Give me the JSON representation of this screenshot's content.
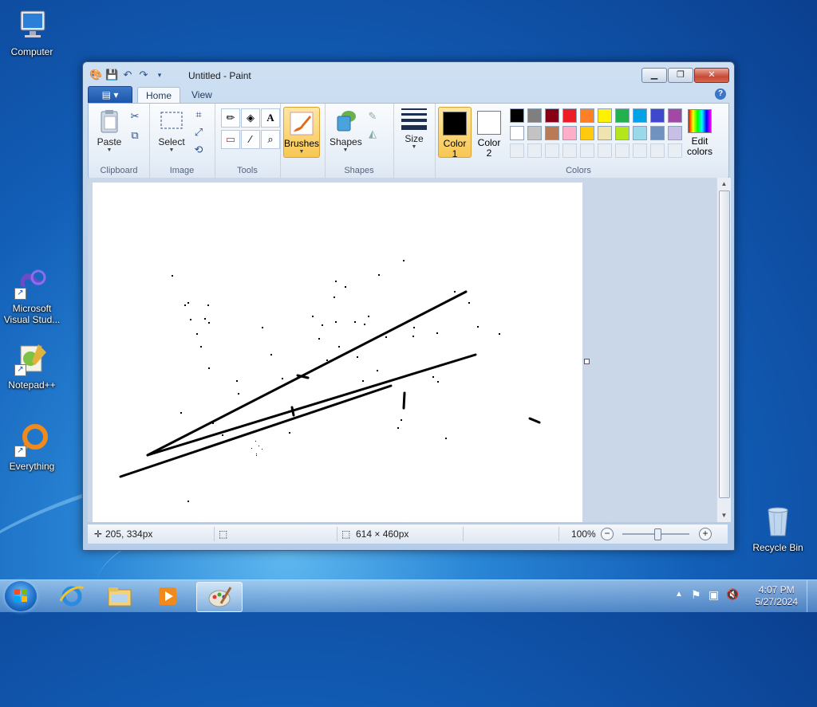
{
  "desktop": {
    "icons": [
      {
        "label": "Computer",
        "icon": "computer-icon"
      },
      {
        "label": "Microsoft Visual Stud...",
        "icon": "visual-studio-icon"
      },
      {
        "label": "Notepad++",
        "icon": "notepadpp-icon"
      },
      {
        "label": "Everything",
        "icon": "everything-icon"
      },
      {
        "label": "Recycle Bin",
        "icon": "recycle-bin-icon"
      }
    ]
  },
  "window": {
    "title": "Untitled - Paint",
    "controls": {
      "minimize": "▁",
      "maximize": "❐",
      "close": "✕"
    }
  },
  "ribbon": {
    "app_menu": "▤ ▾",
    "tabs": [
      "Home",
      "View"
    ],
    "active_tab": "Home",
    "help": "?",
    "groups": {
      "clipboard": {
        "label": "Clipboard",
        "paste": "Paste"
      },
      "image": {
        "label": "Image",
        "select": "Select"
      },
      "tools": {
        "label": "Tools"
      },
      "brushes": {
        "label": "Brushes"
      },
      "shapes": {
        "label": "Shapes",
        "shapes_btn": "Shapes"
      },
      "size": {
        "label": "Size"
      },
      "colors": {
        "label": "Colors",
        "color1": {
          "label": "Color",
          "num": "1",
          "value": "#000000"
        },
        "color2": {
          "label": "Color",
          "num": "2",
          "value": "#ffffff"
        },
        "edit_colors": {
          "line1": "Edit",
          "line2": "colors"
        },
        "palette_row1": [
          "#000000",
          "#7f7f7f",
          "#880015",
          "#ed1c24",
          "#ff7f27",
          "#fff200",
          "#22b14c",
          "#00a2e8",
          "#3f48cc",
          "#a349a4"
        ],
        "palette_row2": [
          "#ffffff",
          "#c3c3c3",
          "#b97a57",
          "#ffaec9",
          "#ffc90e",
          "#efe4b0",
          "#b5e61d",
          "#99d9ea",
          "#7092be",
          "#c8bfe7"
        ]
      }
    }
  },
  "status": {
    "cursor_pos": "205, 334px",
    "canvas_size": "614 × 460px",
    "zoom": "100%"
  },
  "taskbar": {
    "time": "4:07 PM",
    "date": "5/27/2024"
  }
}
